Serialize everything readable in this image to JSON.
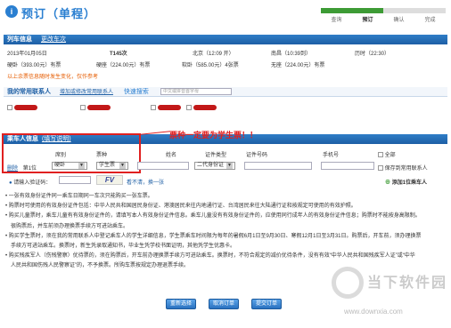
{
  "header": {
    "title": "预订（单程）",
    "icon": "i"
  },
  "steps": [
    "查询",
    "预订",
    "确认",
    "完成"
  ],
  "train_info": {
    "section_title": "列车信息",
    "rechoose_link": "更改车次",
    "date": "2013年01月05日",
    "train": "T145次",
    "from": "北京（12:09 开）",
    "to": "南昌（10:39到）",
    "duration": "历时（22:30）",
    "seats": [
      "硬卧（393.00元）有票",
      "硬座（224.00元）有票",
      "软卧（585.00元）4张票",
      "无座（224.00元）有票"
    ],
    "price_note": "以上余票信息随时发生变化，仅作参考"
  },
  "contacts": {
    "section_title": "我的常用联系人",
    "add_link": "增加或修改常用联系人",
    "quick_search_label": "快速搜索",
    "quick_search_placeholder": "中文或拼音首字母"
  },
  "passenger": {
    "section_title": "乘车人信息",
    "help_link": "(填写说明)",
    "annotation": "票种一定要为学生票！！",
    "headers": [
      "席别",
      "票种",
      "姓名",
      "证件类型",
      "证件号码",
      "手机号"
    ],
    "select_all": "全部",
    "delete_link": "删除",
    "seat_no": "第1位",
    "seat_value": "硬卧",
    "ticket_type_value": "学生票",
    "id_type_value": "二代身份证",
    "save_contact": "保存到常用联系人",
    "add_passenger": "添加1位乘车人",
    "captcha_label": "请输入验证码：",
    "captcha_refresh": "看不清，换一张",
    "captcha_text": "FV"
  },
  "notes": [
    "一张有效身份证件同一乘车日期同一车次只能购买一张车票。",
    "购票时可使用的有效身份证件包括：中华人民共和国居民身份证、港澳居民来往内地通行证、台湾居民来往大陆通行证和按规定可使用的有效护照。",
    "购买儿童票时，乘车儿童有有效身份证件的，请填写本人有效身份证件信息。乘车儿童没有有效身份证件的，应使用同行成年人的有效身份证件信息；购票时不能按身高限制。",
    "很购票后，并车前须办理换票手续方可进站乘车。",
    "购买学生票时，须在我的常用联系人中登记乘车人的学生详细信息，学生票乘车时间限为每年的暑假6月1日至9月30日、寒假12月1日至3月31日。购票后，开车前，须办理换票",
    "手续方可进站乘车。换票时，新生凭录取通知书，毕业生凭学校书面证明，其他凭学生优惠卡。",
    "购买残疾军人（伤残警察）优待票的，须在购票后，开车前办理换票手续方可进站乘车。换票时，不符合规定的减价优待条件，没有有效“中华人民共和国残疾军人证”或“中华",
    "人民共和国伤残人民警察证”的，不予换票。所购车票按规定办理退票手续。"
  ],
  "buttons": {
    "rechoose": "重新选择",
    "cancel": "取消订单",
    "submit": "提交订单"
  },
  "watermark": {
    "brand": "当下软件园",
    "url": "www.downxia.com"
  }
}
